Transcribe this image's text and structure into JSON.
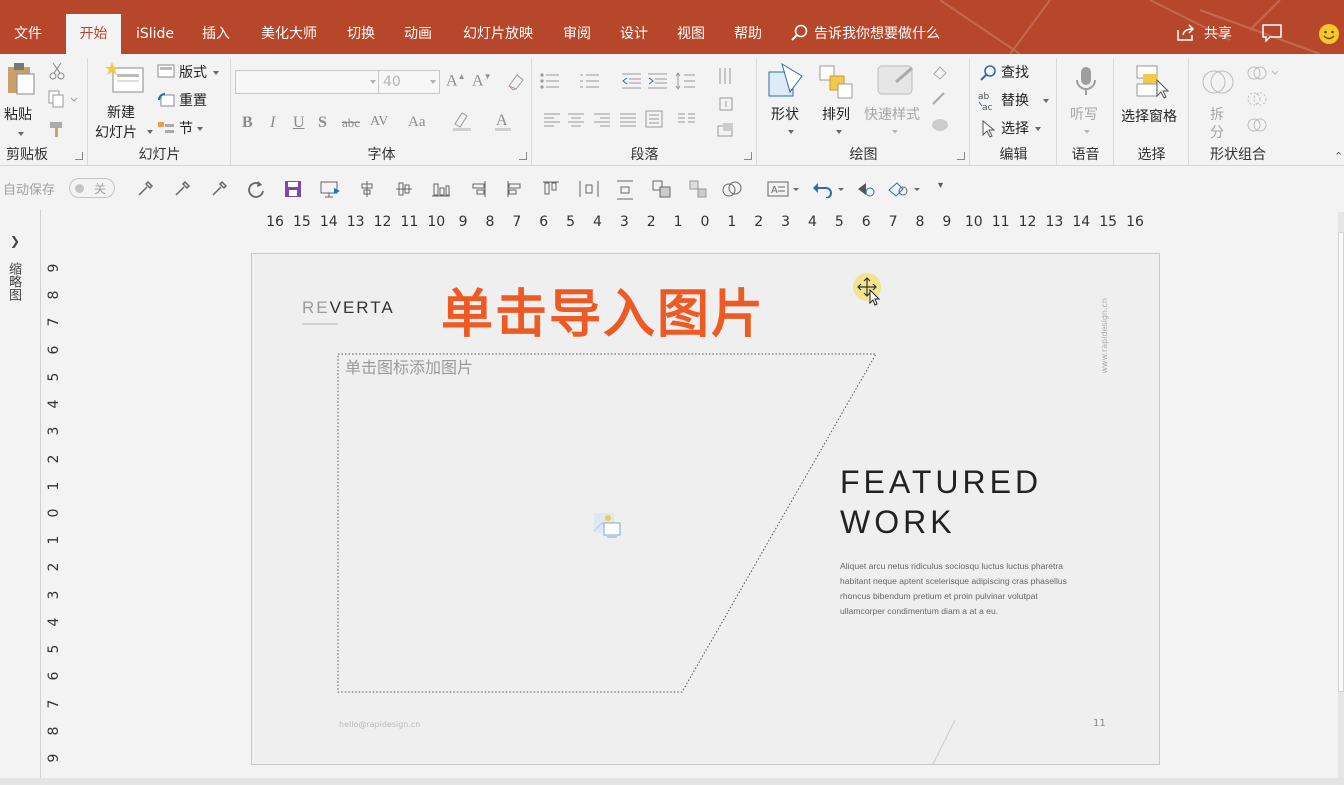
{
  "tabs": [
    {
      "label": "文件"
    },
    {
      "label": "开始"
    },
    {
      "label": "iSlide"
    },
    {
      "label": "插入"
    },
    {
      "label": "美化大师"
    },
    {
      "label": "切换"
    },
    {
      "label": "动画"
    },
    {
      "label": "幻灯片放映"
    },
    {
      "label": "审阅"
    },
    {
      "label": "设计"
    },
    {
      "label": "视图"
    },
    {
      "label": "帮助"
    }
  ],
  "tell_me": "告诉我你想要做什么",
  "share": "共享",
  "ribbon": {
    "clipboard": {
      "paste": "粘贴",
      "label": "剪贴板"
    },
    "slides": {
      "new_line1": "新建",
      "new_line2": "幻灯片",
      "layout": "版式",
      "reset": "重置",
      "section": "节",
      "label": "幻灯片"
    },
    "font": {
      "size": "40",
      "bold": "B",
      "italic": "I",
      "underline": "U",
      "shadow": "S",
      "strike": "abc",
      "spacing": "AV",
      "case": "Aa",
      "label": "字体"
    },
    "paragraph": {
      "label": "段落"
    },
    "drawing": {
      "shapes": "形状",
      "arrange": "排列",
      "quick_styles": "快速样式",
      "label": "绘图"
    },
    "editing": {
      "find": "查找",
      "replace": "替换",
      "select": "选择",
      "label": "编辑"
    },
    "voice": {
      "dictate": "听写",
      "label": "语音"
    },
    "selection": {
      "pane": "选择窗格",
      "label": "选择"
    },
    "shape_combine": {
      "split_line1": "拆",
      "split_line2": "分",
      "label": "形状组合"
    }
  },
  "qat": {
    "autosave": "自动保存",
    "toggle": "关"
  },
  "hruler": [
    "16",
    "15",
    "14",
    "13",
    "12",
    "11",
    "10",
    "9",
    "8",
    "7",
    "6",
    "5",
    "4",
    "3",
    "2",
    "1",
    "0",
    "1",
    "2",
    "3",
    "4",
    "5",
    "6",
    "7",
    "8",
    "9",
    "10",
    "11",
    "12",
    "13",
    "14",
    "15",
    "16"
  ],
  "vruler": [
    "9",
    "8",
    "7",
    "6",
    "5",
    "4",
    "3",
    "2",
    "1",
    "0",
    "1",
    "2",
    "3",
    "4",
    "5",
    "6",
    "7",
    "8",
    "9"
  ],
  "thumbnails_label": "缩略图",
  "slide": {
    "brand_prefix": "RE",
    "brand_rest": "VERTA",
    "headline": "单击导入图片",
    "placeholder": "单击图标添加图片",
    "site": "www.rapidesign.cn",
    "featured_line1": "FEATURED",
    "featured_line2": "WORK",
    "body": "Aliquet arcu netus ridiculus sociosqu luctus luctus pharetra habitant neque aptent scelerisque adipiscing cras phasellus rhoncus bibendum pretium et proin pulvinar volutpat ullamcorper condimentum diam a at a eu.",
    "email": "hello@rapidesign.cn",
    "page_number": "11"
  },
  "colors": {
    "tab_bar": "#b7472a",
    "headline": "#ee5a24",
    "accent_active": "#b7472a"
  }
}
